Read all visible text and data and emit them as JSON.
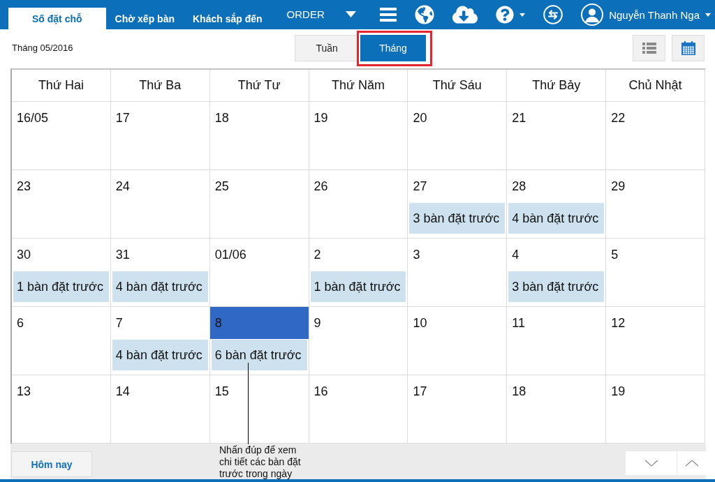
{
  "top_bar": {
    "tabs": [
      {
        "label": "Số đặt chỗ",
        "selected": true
      },
      {
        "label": "Chờ xếp bàn",
        "selected": false
      },
      {
        "label": "Khách sắp đến",
        "selected": false
      }
    ],
    "order_menu": {
      "label": "ORDER"
    },
    "user": {
      "name": "Nguyễn Thanh Nga"
    }
  },
  "toolbar": {
    "period": "Tháng 05/2016",
    "views": [
      {
        "label": "Tuần",
        "selected": false,
        "highlighted": false
      },
      {
        "label": "Tháng",
        "selected": true,
        "highlighted": true
      }
    ]
  },
  "calendar": {
    "weekdays": [
      "Thứ Hai",
      "Thứ Ba",
      "Thứ Tư",
      "Thứ Năm",
      "Thứ Sáu",
      "Thứ Bảy",
      "Chủ Nhật"
    ],
    "weeks": [
      {
        "days": [
          {
            "date": "16/05",
            "selected": false
          },
          {
            "date": "17",
            "selected": false
          },
          {
            "date": "18",
            "selected": false
          },
          {
            "date": "19",
            "selected": false
          },
          {
            "date": "20",
            "selected": false
          },
          {
            "date": "21",
            "selected": false
          },
          {
            "date": "22",
            "selected": false
          }
        ]
      },
      {
        "days": [
          {
            "date": "23",
            "selected": false
          },
          {
            "date": "24",
            "selected": false
          },
          {
            "date": "25",
            "selected": false
          },
          {
            "date": "26",
            "selected": false
          },
          {
            "date": "27",
            "selected": false,
            "bookings": "3 bàn đặt trước"
          },
          {
            "date": "28",
            "selected": false,
            "bookings": "4 bàn đặt trước"
          },
          {
            "date": "29",
            "selected": false
          }
        ]
      },
      {
        "days": [
          {
            "date": "30",
            "selected": false,
            "bookings": "1 bàn đặt trước"
          },
          {
            "date": "31",
            "selected": false,
            "bookings": "4 bàn đặt trước"
          },
          {
            "date": "01/06",
            "selected": false
          },
          {
            "date": "2",
            "selected": false,
            "bookings": "1 bàn đặt trước"
          },
          {
            "date": "3",
            "selected": false
          },
          {
            "date": "4",
            "selected": false,
            "bookings": "3 bàn đặt trước"
          },
          {
            "date": "5",
            "selected": false
          }
        ]
      },
      {
        "days": [
          {
            "date": "6",
            "selected": false
          },
          {
            "date": "7",
            "selected": false,
            "bookings": "4 bàn đặt trước"
          },
          {
            "date": "8",
            "selected": true,
            "bookings": "6 bàn đặt trước"
          },
          {
            "date": "9",
            "selected": false
          },
          {
            "date": "10",
            "selected": false
          },
          {
            "date": "11",
            "selected": false
          },
          {
            "date": "12",
            "selected": false
          }
        ]
      },
      {
        "days": [
          {
            "date": "13",
            "selected": false
          },
          {
            "date": "14",
            "selected": false
          },
          {
            "date": "15",
            "selected": false
          },
          {
            "date": "16",
            "selected": false
          },
          {
            "date": "17",
            "selected": false
          },
          {
            "date": "18",
            "selected": false
          },
          {
            "date": "19",
            "selected": false
          }
        ]
      }
    ]
  },
  "footer": {
    "today_button": "Hôm nay"
  },
  "callout": {
    "text": "Nhấn đúp để xem chi tiết các bàn đặt trước trong ngày"
  }
}
